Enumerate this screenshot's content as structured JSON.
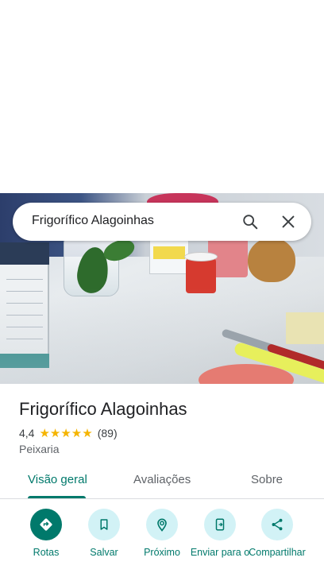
{
  "search": {
    "query": "Frigorífico Alagoinhas"
  },
  "place": {
    "name": "Frigorífico Alagoinhas",
    "rating": "4,4",
    "stars": "★★★★★",
    "reviews_count": "(89)",
    "category": "Peixaria"
  },
  "tabs": [
    {
      "label": "Visão geral"
    },
    {
      "label": "Avaliações"
    },
    {
      "label": "Sobre"
    }
  ],
  "actions": [
    {
      "label": "Rotas",
      "icon": "directions-icon"
    },
    {
      "label": "Salvar",
      "icon": "bookmark-icon"
    },
    {
      "label": "Próximo",
      "icon": "nearby-icon"
    },
    {
      "label": "Enviar para o",
      "icon": "send-to-phone-icon"
    },
    {
      "label": "Compartilhar",
      "icon": "share-icon"
    }
  ],
  "colors": {
    "accent": "#00796b",
    "action_bg": "#d2f2f6",
    "star": "#f5b400"
  }
}
